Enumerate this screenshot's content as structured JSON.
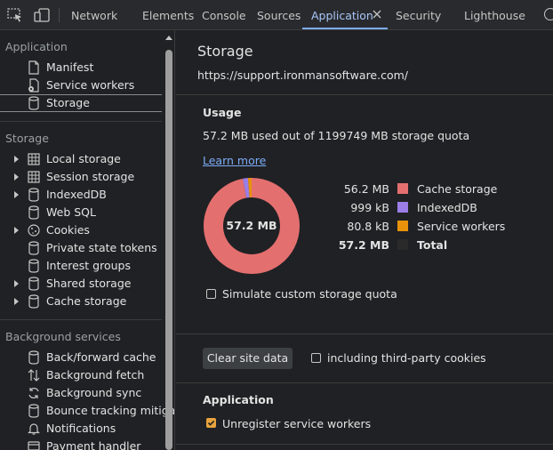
{
  "toolbar": {
    "tabs": [
      "Network",
      "Elements",
      "Console",
      "Sources",
      "Application",
      "Security",
      "Lighthouse"
    ],
    "active_tab": "Application"
  },
  "sidebar": {
    "application": {
      "title": "Application",
      "items": [
        {
          "label": "Manifest",
          "icon": "document-icon"
        },
        {
          "label": "Service workers",
          "icon": "service-worker-icon"
        },
        {
          "label": "Storage",
          "icon": "database-icon",
          "selected": true
        }
      ]
    },
    "storage": {
      "title": "Storage",
      "items": [
        {
          "label": "Local storage",
          "icon": "table-icon",
          "expandable": true
        },
        {
          "label": "Session storage",
          "icon": "table-icon",
          "expandable": true
        },
        {
          "label": "IndexedDB",
          "icon": "database-icon",
          "expandable": true
        },
        {
          "label": "Web SQL",
          "icon": "database-icon",
          "expandable": false
        },
        {
          "label": "Cookies",
          "icon": "cookie-icon",
          "expandable": true
        },
        {
          "label": "Private state tokens",
          "icon": "database-icon",
          "expandable": false
        },
        {
          "label": "Interest groups",
          "icon": "database-icon",
          "expandable": false
        },
        {
          "label": "Shared storage",
          "icon": "database-icon",
          "expandable": true
        },
        {
          "label": "Cache storage",
          "icon": "database-icon",
          "expandable": true
        }
      ]
    },
    "background": {
      "title": "Background services",
      "items": [
        {
          "label": "Back/forward cache",
          "icon": "database-icon"
        },
        {
          "label": "Background fetch",
          "icon": "up-down-arrows-icon"
        },
        {
          "label": "Background sync",
          "icon": "sync-icon"
        },
        {
          "label": "Bounce tracking mitigatio",
          "icon": "database-icon"
        },
        {
          "label": "Notifications",
          "icon": "bell-icon"
        },
        {
          "label": "Payment handler",
          "icon": "card-icon"
        }
      ]
    }
  },
  "main": {
    "title": "Storage",
    "url": "https://support.ironmansoftware.com/",
    "usage": {
      "heading": "Usage",
      "summary": "57.2 MB used out of 1199749 MB storage quota",
      "learn_more": "Learn more",
      "total_center": "57.2 MB",
      "simulate_label": "Simulate custom storage quota",
      "simulate_checked": false
    },
    "clear_button": "Clear site data",
    "third_party_label": "including third-party cookies",
    "third_party_checked": false,
    "application": {
      "heading": "Application",
      "unregister_label": "Unregister service workers",
      "unregister_checked": true
    }
  },
  "chart_data": {
    "type": "pie",
    "categories": [
      "Cache storage",
      "IndexedDB",
      "Service workers"
    ],
    "values": [
      56.2,
      0.999,
      0.0808
    ],
    "value_labels": [
      "56.2 MB",
      "999 kB",
      "80.8 kB"
    ],
    "colors": [
      "#e46f6f",
      "#9b7ee8",
      "#e8920c"
    ],
    "total_label": "Total",
    "total_value": "57.2 MB"
  },
  "colors": {
    "accent": "#7cacf8",
    "checkbox_checked": "#e8a33d",
    "background": "#202124"
  }
}
